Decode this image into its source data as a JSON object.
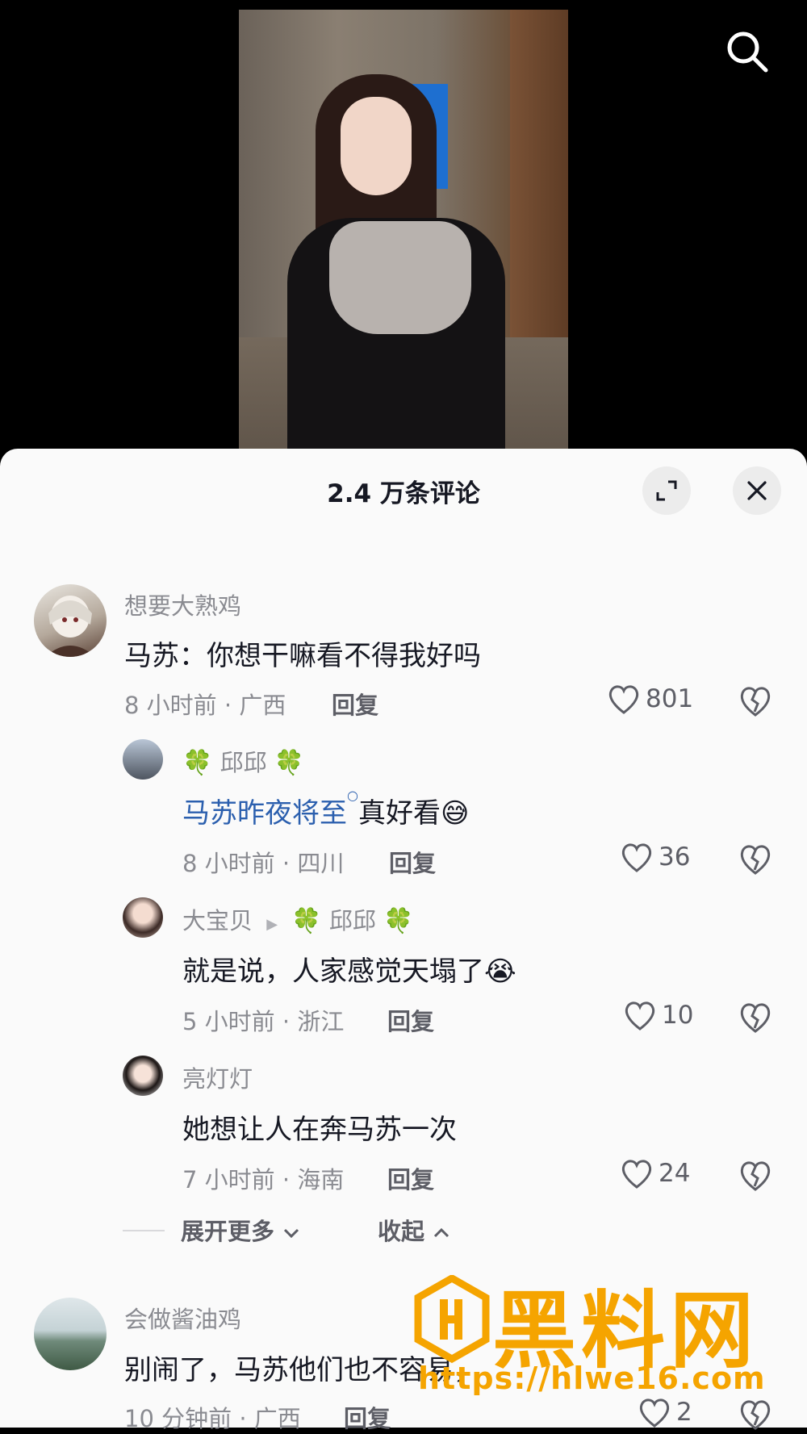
{
  "sheet": {
    "title": "2.4 万条评论"
  },
  "comments": [
    {
      "username": "想要大熟鸡",
      "text": "马苏：你想干嘛看不得我好吗",
      "meta": "8 小时前 · 广西",
      "reply_label": "回复",
      "likes": "801"
    },
    {
      "username": "邱邱",
      "mention": "马苏昨夜将至",
      "text": "真好看",
      "emoji": "😅",
      "meta": "8 小时前 · 四川",
      "reply_label": "回复",
      "likes": "36"
    },
    {
      "username": "大宝贝",
      "reply_to": "邱邱",
      "text": "就是说，人家感觉天塌了",
      "emoji": "😭",
      "meta": "5 小时前 · 浙江",
      "reply_label": "回复",
      "likes": "10"
    },
    {
      "username": "亮灯灯",
      "text": "她想让人在奔马苏一次",
      "meta": "7 小时前 · 海南",
      "reply_label": "回复",
      "likes": "24"
    },
    {
      "username": "会做酱油鸡",
      "text": "别闹了，马苏他们也不容易，",
      "meta": "10 分钟前 · 广西",
      "reply_label": "回复",
      "likes": "2"
    }
  ],
  "thread_controls": {
    "expand_more": "展开更多",
    "collapse": "收起"
  },
  "watermark": {
    "title": "黑料网",
    "url": "https://hlwe16.com"
  },
  "colors": {
    "accent_mention": "#2b5fae",
    "watermark": "#f5a400",
    "clover": "#2e9d3d"
  },
  "icons": [
    "search-icon",
    "expand-icon",
    "close-icon",
    "heart-icon",
    "broken-heart-icon",
    "clover-icon",
    "chevron-down-icon",
    "chevron-up-icon",
    "play-triangle-icon"
  ]
}
